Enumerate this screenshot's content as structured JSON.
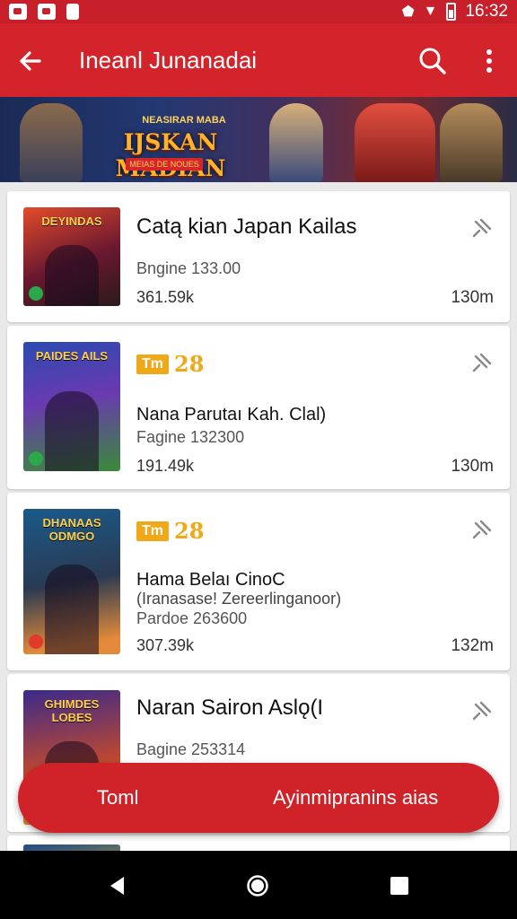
{
  "status_bar": {
    "time": "16:32",
    "left_icons": [
      "photo-icon",
      "photo-icon",
      "doc-icon"
    ],
    "right_icons": [
      "alarm-icon",
      "wifi-icon",
      "battery-icon"
    ]
  },
  "app_bar": {
    "title": "Ineanl Junanadai",
    "icons": [
      "back-arrow-icon",
      "search-icon",
      "more-vert-icon"
    ]
  },
  "banner": {
    "small_text": "NEASIRAR MABA",
    "big_text": "IJSKAN MADIAN",
    "plate_text": "MEIAS DE NOUES"
  },
  "items": [
    {
      "thumb_title": "DEYINDAS",
      "name": "Catą kian  Japan Kailas",
      "engine": "Bngine 133.00",
      "count": "361.59k",
      "size": "130m",
      "thumb_badge": "green"
    },
    {
      "thumb_title": "PAIDES AILS",
      "tag_box": "Tm",
      "tag_num": "28",
      "name": "Nana Parutaı Kah. Clal)",
      "engine": "Fagine 132300",
      "count": "191.49k",
      "size": "130m",
      "thumb_badge": "green"
    },
    {
      "thumb_title": "DHANAAS ODMGO",
      "tag_box": "Tm",
      "tag_num": "28",
      "name": "Hama Belaı CinoC",
      "subtitle": "(Iranasase! Zereerlinganoor)",
      "engine": "Pardoe 263600",
      "count": "307.39k",
      "size": "132m",
      "thumb_badge": "red"
    },
    {
      "thumb_title": "GHIMDES LOBES",
      "name": "Naran Sairon Aslǫ(I",
      "engine": "Bagine 253314"
    },
    {
      "thumb_title": ""
    }
  ],
  "fab": {
    "left_label": "Toml",
    "right_label": "Ayinmipranins aias"
  },
  "nav_bar": {
    "icons": [
      "back-triangle-icon",
      "home-circle-icon",
      "recents-square-icon"
    ]
  },
  "colors": {
    "primary": "#d3242c",
    "accent": "#f0a818",
    "background": "#e9e9e9"
  }
}
